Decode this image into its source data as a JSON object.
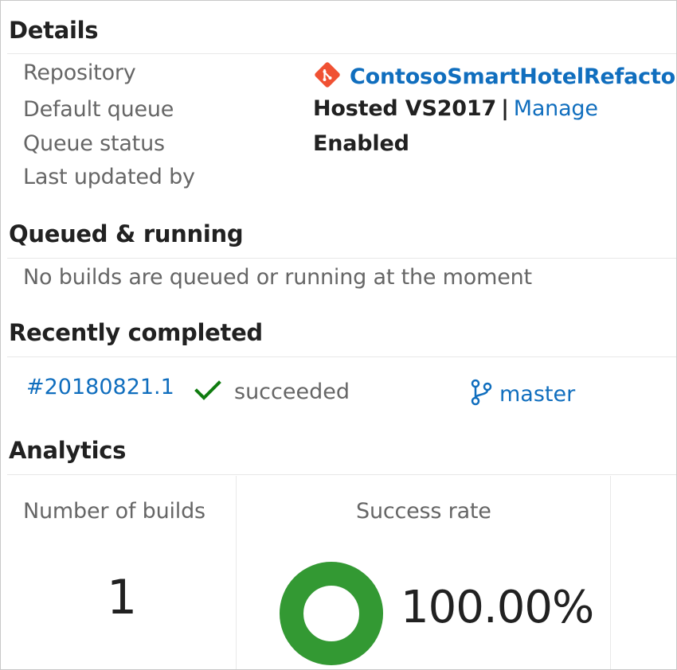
{
  "details": {
    "title": "Details",
    "repository_label": "Repository",
    "repository_value": "ContosoSmartHotelRefactor",
    "default_queue_label": "Default queue",
    "default_queue_value": "Hosted VS2017",
    "default_queue_separator": "|",
    "manage_link": "Manage",
    "queue_status_label": "Queue status",
    "queue_status_value": "Enabled",
    "last_updated_label": "Last updated by"
  },
  "queued": {
    "title": "Queued & running",
    "message": "No builds are queued or running at the moment"
  },
  "recent": {
    "title": "Recently completed",
    "builds": [
      {
        "number": "#20180821.1",
        "status": "succeeded",
        "status_icon": "check-icon",
        "branch": "master",
        "branch_icon": "branch-icon"
      }
    ]
  },
  "analytics": {
    "title": "Analytics",
    "tiles": [
      {
        "title": "Number of builds",
        "value": "1"
      },
      {
        "title": "Success rate",
        "value": "100.00%",
        "rate": 1.0
      }
    ]
  },
  "colors": {
    "link": "#106ebe",
    "success": "#339933",
    "check": "#107c10",
    "git": "#f05133"
  }
}
